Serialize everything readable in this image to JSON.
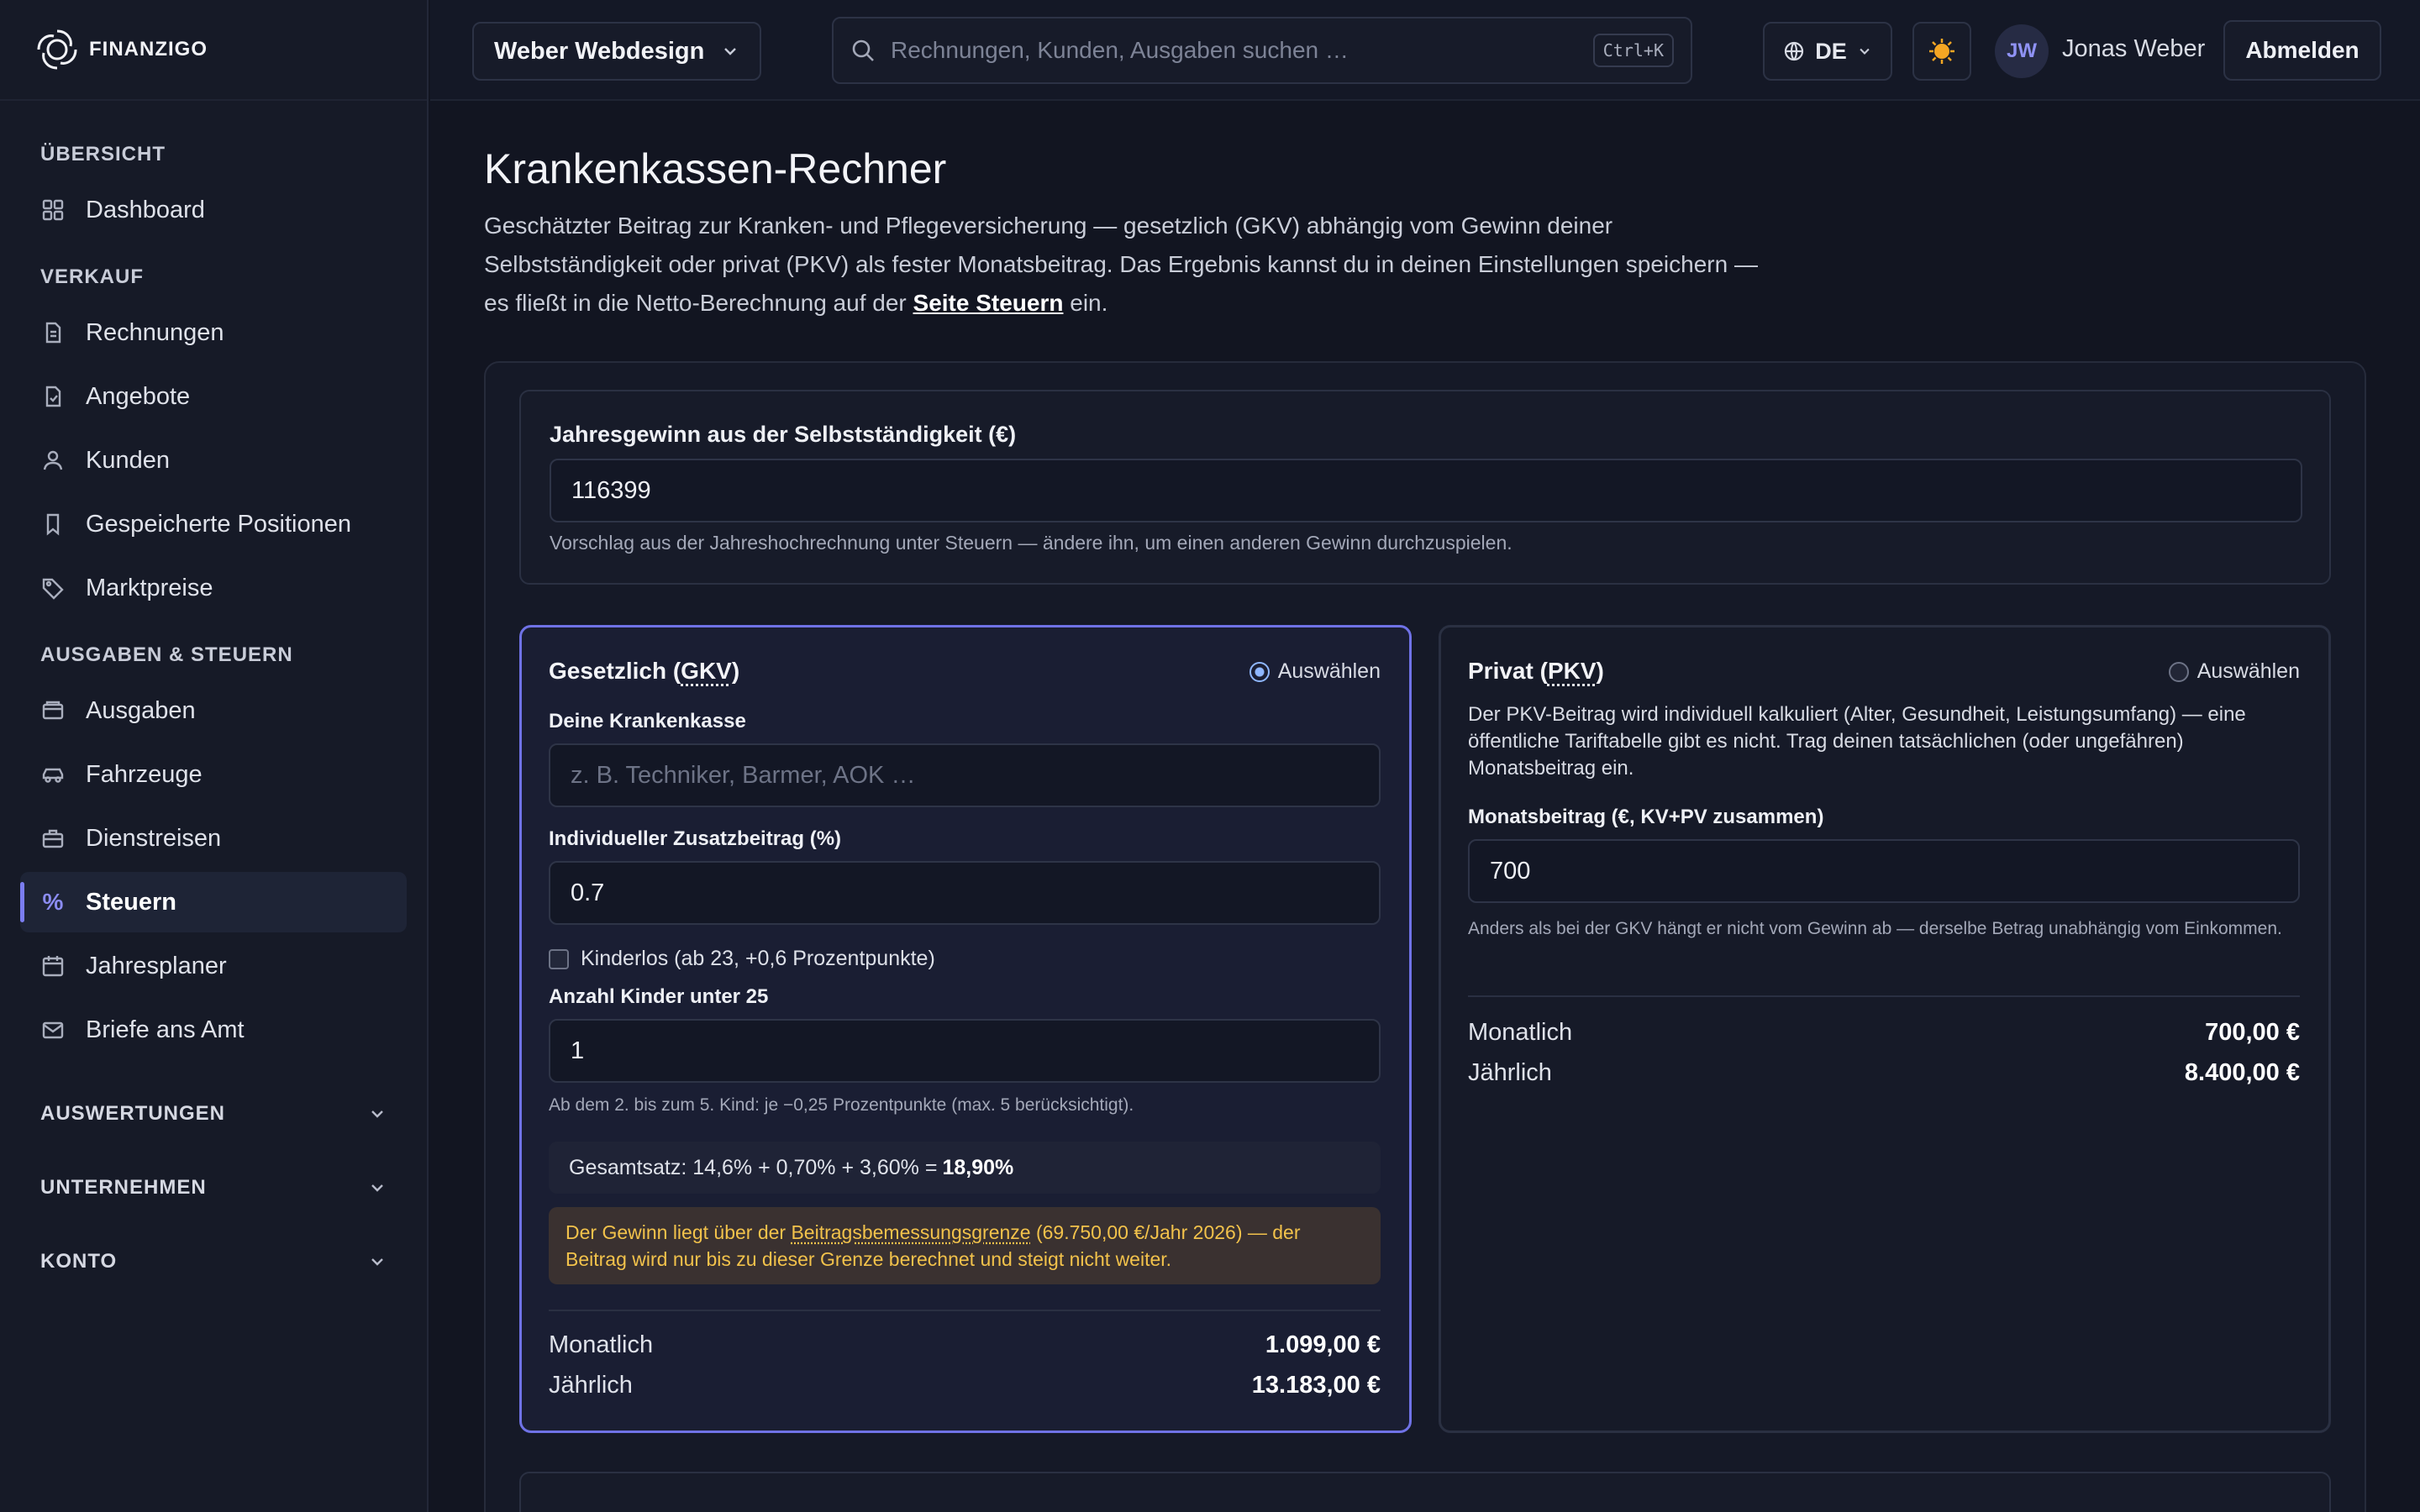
{
  "brand": {
    "name": "FINANZIGO"
  },
  "sidebar": {
    "sections": [
      {
        "title": "ÜBERSICHT",
        "items": [
          {
            "label": "Dashboard",
            "icon": "grid-icon"
          }
        ]
      },
      {
        "title": "VERKAUF",
        "items": [
          {
            "label": "Rechnungen",
            "icon": "document-icon"
          },
          {
            "label": "Angebote",
            "icon": "document-check-icon"
          },
          {
            "label": "Kunden",
            "icon": "user-icon"
          },
          {
            "label": "Gespeicherte Positionen",
            "icon": "bookmark-icon"
          },
          {
            "label": "Marktpreise",
            "icon": "tag-icon"
          }
        ]
      },
      {
        "title": "AUSGABEN & STEUERN",
        "items": [
          {
            "label": "Ausgaben",
            "icon": "wallet-icon"
          },
          {
            "label": "Fahrzeuge",
            "icon": "car-icon"
          },
          {
            "label": "Dienstreisen",
            "icon": "briefcase-icon"
          },
          {
            "label": "Steuern",
            "icon": "percent-icon",
            "active": true
          },
          {
            "label": "Jahresplaner",
            "icon": "calendar-icon"
          },
          {
            "label": "Briefe ans Amt",
            "icon": "mail-icon"
          }
        ]
      }
    ],
    "collapsed": [
      "AUSWERTUNGEN",
      "UNTERNEHMEN",
      "KONTO"
    ]
  },
  "header": {
    "company": "Weber Webdesign",
    "search_placeholder": "Rechnungen, Kunden, Ausgaben suchen …",
    "shortcut": "Ctrl+K",
    "language": "DE",
    "avatar_initials": "JW",
    "username": "Jonas Weber",
    "logout": "Abmelden"
  },
  "page": {
    "title": "Krankenkassen-Rechner",
    "desc_before": "Geschätzter Beitrag zur Kranken- und Pflegeversicherung — gesetzlich (GKV) abhängig vom Gewinn deiner Selbstständigkeit oder privat (PKV) als fester Monatsbeitrag. Das Ergebnis kannst du in deinen Einstellungen speichern — es fließt in die Netto-Berechnung auf der ",
    "desc_link": "Seite Steuern",
    "desc_after": " ein."
  },
  "profit": {
    "label": "Jahresgewinn aus der Selbstständigkeit (€)",
    "value": "116399",
    "hint": "Vorschlag aus der Jahreshochrechnung unter Steuern — ändere ihn, um einen anderen Gewinn durchzuspielen."
  },
  "gkv": {
    "title_prefix": "Gesetzlich (",
    "title_abbr": "GKV",
    "title_suffix": ")",
    "select_label": "Auswählen",
    "selected": true,
    "kasse_label": "Deine Krankenkasse",
    "kasse_placeholder": "z. B. Techniker, Barmer, AOK …",
    "zusatz_label": "Individueller Zusatzbeitrag (%)",
    "zusatz_value": "0.7",
    "kinderlos_label": "Kinderlos (ab 23, +0,6 Prozentpunkte)",
    "kinder_label": "Anzahl Kinder unter 25",
    "kinder_value": "1",
    "kinder_hint": "Ab dem 2. bis zum 5. Kind: je −0,25 Prozentpunkte (max. 5 berücksichtigt).",
    "rate_text": "Gesamtsatz: 14,6% + 0,70% + 3,60% =",
    "rate_total": "18,90%",
    "warn_before": "Der Gewinn liegt über der ",
    "warn_link": "Beitragsbemessungsgrenze",
    "warn_after": " (69.750,00 €/Jahr 2026) — der Beitrag wird nur bis zu dieser Grenze berechnet und steigt nicht weiter.",
    "monthly_label": "Monatlich",
    "monthly_value": "1.099,00 €",
    "yearly_label": "Jährlich",
    "yearly_value": "13.183,00 €"
  },
  "pkv": {
    "title_prefix": "Privat (",
    "title_abbr": "PKV",
    "title_suffix": ")",
    "select_label": "Auswählen",
    "selected": false,
    "desc": "Der PKV-Beitrag wird individuell kalkuliert (Alter, Gesundheit, Leistungsumfang) — eine öffentliche Tariftabelle gibt es nicht. Trag deinen tatsächlichen (oder ungefähren) Monatsbeitrag ein.",
    "beitrag_label": "Monatsbeitrag (€, KV+PV zusammen)",
    "beitrag_value": "700",
    "hint": "Anders als bei der GKV hängt er nicht vom Gewinn ab — derselbe Betrag unabhängig vom Einkommen.",
    "monthly_label": "Monatlich",
    "monthly_value": "700,00 €",
    "yearly_label": "Jährlich",
    "yearly_value": "8.400,00 €"
  },
  "colors": {
    "accent": "#7b7df0",
    "warning": "#f2c24b",
    "background": "#121521"
  }
}
